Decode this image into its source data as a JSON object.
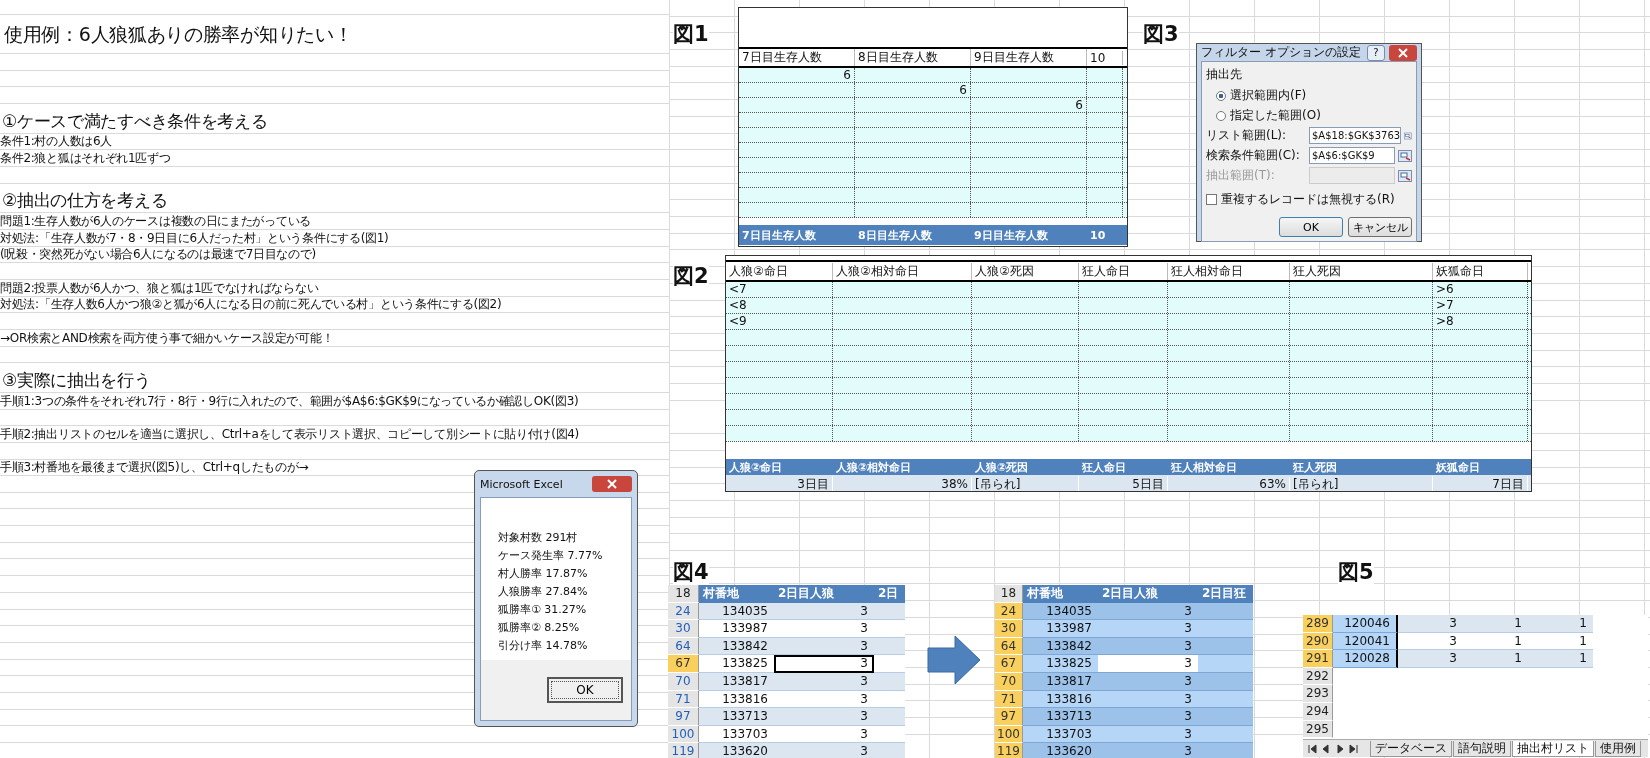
{
  "left": {
    "title": "使用例：6人狼狐ありの勝率が知りたい！",
    "sections": [
      {
        "heading": "①ケースで満たすべき条件を考える",
        "paragraphs": [
          [
            "条件1:村の人数は6人",
            "条件2:狼と狐はそれぞれ1匹ずつ"
          ]
        ]
      },
      {
        "heading": "②抽出の仕方を考える",
        "paragraphs": [
          [
            "問題1:生存人数が6人のケースは複数の日にまたがっている",
            "対処法:「生存人数が7・8・9日目に6人だった村」という条件にする(図1)",
            "(呪殺・突然死がない場合6人になるのは最速で7日目なので)"
          ],
          [
            "問題2:投票人数が6人かつ、狼と狐は1匹でなければならない",
            "対処法:「生存人数6人かつ狼②と狐が6人になる日の前に死んでいる村」という条件にする(図2)"
          ],
          [
            "→OR検索とAND検索を両方使う事で細かいケース設定が可能！"
          ]
        ]
      },
      {
        "heading": "③実際に抽出を行う",
        "paragraphs": [
          [
            "手順1:3つの条件をそれぞれ7行・8行・9行に入れたので、範囲が$A$6:$GK$9になっているか確認しOK(図3)"
          ],
          [
            "手順2:抽出リストのセルを適当に選択し、Ctrl+aをして表示リスト選択、コピーして別シートに貼り付け(図4)"
          ],
          [
            "手順3:村番地を最後まで選択(図5)し、Ctrl+qしたものが→"
          ]
        ]
      }
    ]
  },
  "fig1": {
    "label": "図1",
    "columns": [
      "7日目生存人数",
      "8日目生存人数",
      "9日目生存人数",
      "10"
    ],
    "rows": [
      [
        "6",
        null,
        null,
        null
      ],
      [
        null,
        "6",
        null,
        null
      ],
      [
        null,
        null,
        "6",
        null
      ]
    ],
    "footer": [
      "7日目生存人数",
      "8日目生存人数",
      "9日目生存人数",
      "10"
    ]
  },
  "fig3": {
    "label": "図3",
    "title": "フィルター オプションの設定",
    "help": "?",
    "group": "抽出先",
    "radios": [
      {
        "label": "選択範囲内(F)",
        "selected": true
      },
      {
        "label": "指定した範囲(O)",
        "selected": false
      }
    ],
    "fields": [
      {
        "label": "リスト範囲(L):",
        "value": "$A$18:$GK$3763",
        "disabled": false
      },
      {
        "label": "検索条件範囲(C):",
        "value": "$A$6:$GK$9",
        "disabled": false
      },
      {
        "label": "抽出範囲(T):",
        "disabled": true
      }
    ],
    "checkbox": {
      "label": "重複するレコードは無視する(R)",
      "checked": false
    },
    "buttons": [
      "OK",
      "キャンセル"
    ]
  },
  "fig2": {
    "label": "図2",
    "columns": [
      "人狼②命日",
      "人狼②相対命日",
      "人狼②死因",
      "狂人命日",
      "狂人相対命日",
      "狂人死因",
      "妖狐命日"
    ],
    "rows": [
      [
        "<7",
        null,
        null,
        null,
        null,
        null,
        ">6"
      ],
      [
        "<8",
        null,
        null,
        null,
        null,
        null,
        ">7"
      ],
      [
        "<9",
        null,
        null,
        null,
        null,
        null,
        ">8"
      ]
    ],
    "footer": [
      "人狼②命日",
      "人狼②相対命日",
      "人狼②死因",
      "狂人命日",
      "狂人相対命日",
      "狂人死因",
      "妖狐命日"
    ],
    "data_row": [
      "3日目",
      "38%",
      "[吊られ]",
      "5日目",
      "63%",
      "[吊られ]",
      "7日目"
    ]
  },
  "message_box": {
    "title": "Microsoft Excel",
    "lines": [
      "対象村数 291村",
      "ケース発生率 7.77%",
      "村人勝率 17.87%",
      "人狼勝率 27.84%",
      "狐勝率① 31.27%",
      "狐勝率② 8.25%",
      "引分け率 14.78%"
    ],
    "button": "OK"
  },
  "fig4": {
    "label": "図4",
    "tables": [
      {
        "corner": "18",
        "columns": [
          "村番地",
          "2日目人狼",
          "2日"
        ],
        "rows": [
          {
            "row": "24",
            "values": [
              "134035",
              "3"
            ],
            "selected": false,
            "active": false
          },
          {
            "row": "30",
            "values": [
              "133987",
              "3"
            ],
            "selected": false,
            "active": false
          },
          {
            "row": "64",
            "values": [
              "133842",
              "3"
            ],
            "selected": false,
            "active": false
          },
          {
            "row": "67",
            "values": [
              "133825",
              "3"
            ],
            "selected": false,
            "active": true
          },
          {
            "row": "70",
            "values": [
              "133817",
              "3"
            ],
            "selected": false,
            "active": false
          },
          {
            "row": "71",
            "values": [
              "133816",
              "3"
            ],
            "selected": false,
            "active": false
          },
          {
            "row": "97",
            "values": [
              "133713",
              "3"
            ],
            "selected": false,
            "active": false
          },
          {
            "row": "100",
            "values": [
              "133703",
              "3"
            ],
            "selected": false,
            "active": false
          },
          {
            "row": "119",
            "values": [
              "133620",
              "3"
            ],
            "selected": false,
            "active": false
          }
        ]
      },
      {
        "corner": "18",
        "columns": [
          "村番地",
          "2日目人狼",
          "2日目狂"
        ],
        "rows": [
          {
            "row": "24",
            "values": [
              "134035",
              "3"
            ],
            "selected": true,
            "active": false
          },
          {
            "row": "30",
            "values": [
              "133987",
              "3"
            ],
            "selected": true,
            "active": false
          },
          {
            "row": "64",
            "values": [
              "133842",
              "3"
            ],
            "selected": true,
            "active": false
          },
          {
            "row": "67",
            "values": [
              "133825",
              "3"
            ],
            "selected": true,
            "active": true
          },
          {
            "row": "70",
            "values": [
              "133817",
              "3"
            ],
            "selected": true,
            "active": false
          },
          {
            "row": "71",
            "values": [
              "133816",
              "3"
            ],
            "selected": true,
            "active": false
          },
          {
            "row": "97",
            "values": [
              "133713",
              "3"
            ],
            "selected": true,
            "active": false
          },
          {
            "row": "100",
            "values": [
              "133703",
              "3"
            ],
            "selected": true,
            "active": false
          },
          {
            "row": "119",
            "values": [
              "133620",
              "3"
            ],
            "selected": true,
            "active": false
          }
        ]
      }
    ]
  },
  "fig5": {
    "label": "図5",
    "rows": [
      {
        "row": "289",
        "values": [
          "120046",
          "3",
          "1",
          "1"
        ],
        "selected": true
      },
      {
        "row": "290",
        "values": [
          "120041",
          "3",
          "1",
          "1"
        ],
        "selected": true
      },
      {
        "row": "291",
        "values": [
          "120028",
          "3",
          "1",
          "1"
        ],
        "selected": true
      },
      {
        "row": "292",
        "selected": false
      },
      {
        "row": "293",
        "selected": false
      },
      {
        "row": "294",
        "selected": false
      },
      {
        "row": "295",
        "selected": false
      }
    ],
    "tabs": [
      {
        "label": "データベース",
        "selected": false
      },
      {
        "label": "語句説明",
        "selected": false
      },
      {
        "label": "抽出村リスト",
        "selected": true
      },
      {
        "label": "使用例",
        "selected": false
      }
    ]
  }
}
